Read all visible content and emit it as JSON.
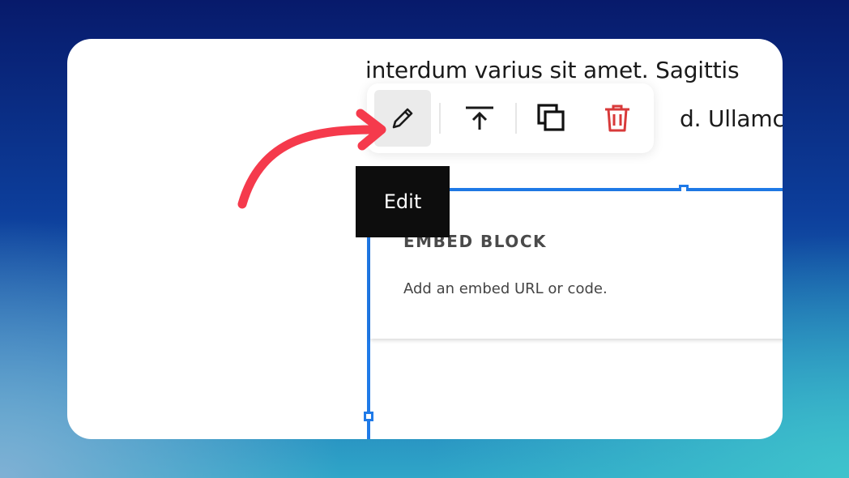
{
  "content": {
    "line1": "interdum varius sit amet. Sagittis",
    "line2": "d. Ullamco"
  },
  "toolbar": {
    "buttons": [
      {
        "icon": "pencil-icon",
        "label": "Edit",
        "active": true
      },
      {
        "icon": "move-to-top-icon",
        "label": ""
      },
      {
        "icon": "duplicate-icon",
        "label": ""
      },
      {
        "icon": "trash-icon",
        "label": "",
        "color": "#d83a3a"
      }
    ]
  },
  "tooltip": {
    "text": "Edit"
  },
  "embed_block": {
    "title": "EMBED BLOCK",
    "hint": "Add an embed URL or code."
  },
  "colors": {
    "selection": "#1f7ae8",
    "annotation_arrow": "#f53a4c",
    "delete": "#d83a3a"
  }
}
